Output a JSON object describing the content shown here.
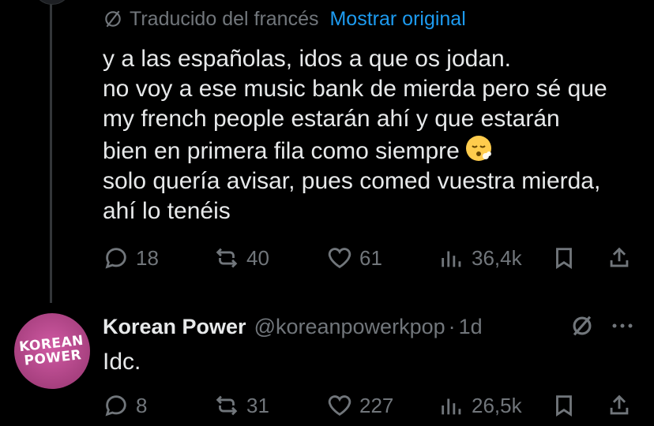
{
  "tweet": {
    "translated_label": "Traducido del francés",
    "show_original_label": "Mostrar original",
    "text": "y a las españolas, idos a que os jodan.\nno voy a ese music bank de mierda pero sé que\nmy french people estarán ahí y que estarán\nbien en primera fila como siempre",
    "text_tail": "solo quería avisar, pues comed vuestra mierda,\nahí lo tenéis",
    "emoji": "face-exhaling-emoji",
    "stats": {
      "replies": "18",
      "reposts": "40",
      "likes": "61",
      "views": "36,4k"
    }
  },
  "reply": {
    "avatar_line1": "KOREAN",
    "avatar_line2": "POWER",
    "name": "Korean Power",
    "handle": "@koreanpowerkpop",
    "separator": "·",
    "time": "1d",
    "text": "Idc.",
    "stats": {
      "replies": "8",
      "reposts": "31",
      "likes": "227",
      "views": "26,5k"
    }
  },
  "colors": {
    "background": "#000000",
    "text": "#e7e9ea",
    "muted": "#71767b",
    "link": "#1d9bf0",
    "avatar": "#b8478d"
  }
}
